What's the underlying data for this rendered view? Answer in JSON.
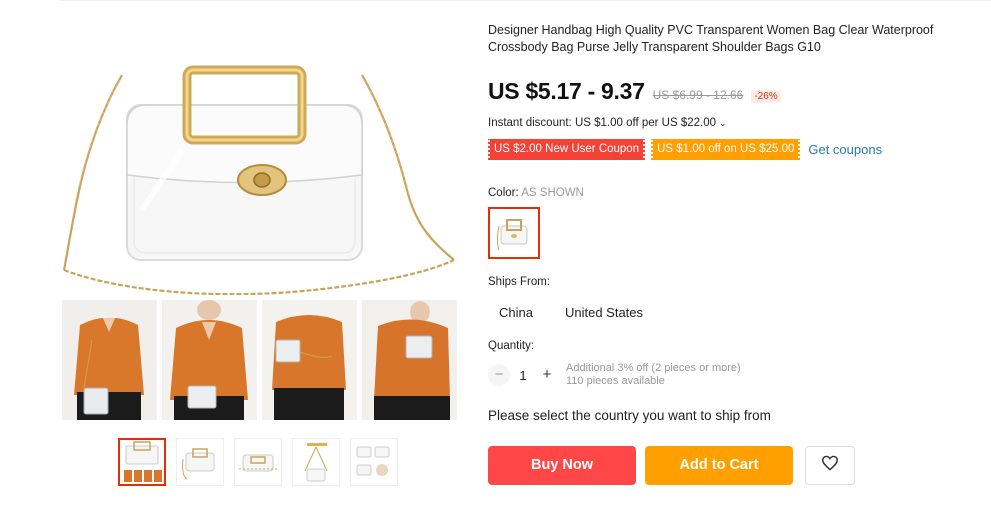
{
  "product": {
    "title": "Designer Handbag High Quality PVC Transparent Women Bag Clear Waterproof Crossbody Bag Purse Jelly Transparent Shoulder Bags G10",
    "price": "US $5.17 - 9.37",
    "original_price": "US $6.99 - 12.66",
    "discount": "-26%"
  },
  "promotions": {
    "instant_discount": "Instant discount: US $1.00 off per US $22.00",
    "coupons": [
      {
        "label": "US $2.00 New User Coupon",
        "color": "#f44336"
      },
      {
        "label": "US $1.00 off on US $25.00",
        "color": "#ff9f00"
      }
    ],
    "get_coupons_label": "Get coupons"
  },
  "color": {
    "label": "Color:",
    "value": "AS SHOWN"
  },
  "shipping": {
    "label": "Ships From:",
    "options": [
      "China",
      "United States"
    ],
    "message": "Please select the country you want to ship from"
  },
  "quantity": {
    "label": "Quantity:",
    "minus": "−",
    "value": "1",
    "plus": "+",
    "note_line1": "Additional 3% off (2 pieces or more)",
    "note_line2": "110 pieces available"
  },
  "actions": {
    "buy_now": "Buy Now",
    "add_to_cart": "Add to Cart",
    "wishlist_icon": "heart-icon"
  },
  "colors": {
    "accent_red": "#ff4747",
    "accent_orange": "#ff9f00",
    "link_blue": "#2a7ab0",
    "sale_red": "#e62e04"
  }
}
